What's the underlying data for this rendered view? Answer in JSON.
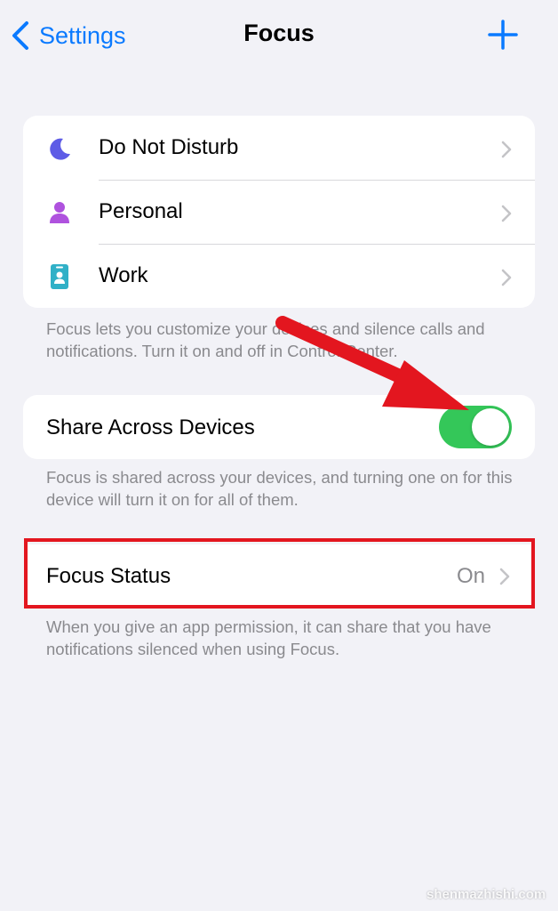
{
  "nav": {
    "back_label": "Settings",
    "title": "Focus"
  },
  "focus_modes": [
    {
      "label": "Do Not Disturb",
      "icon": "moon-icon",
      "color": "#5e5ce6"
    },
    {
      "label": "Personal",
      "icon": "person-icon",
      "color": "#af52de"
    },
    {
      "label": "Work",
      "icon": "id-badge-icon",
      "color": "#30b0c7"
    }
  ],
  "focus_modes_footer": "Focus lets you customize your devices and silence calls and notifications. Turn it on and off in Control Center.",
  "share": {
    "label": "Share Across Devices",
    "enabled": true,
    "footer": "Focus is shared across your devices, and turning one on for this device will turn it on for all of them."
  },
  "focus_status": {
    "label": "Focus Status",
    "value": "On",
    "footer": "When you give an app permission, it can share that you have notifications silenced when using Focus."
  },
  "watermark": "shenmazhishi.com",
  "colors": {
    "accent": "#0a7aff",
    "toggle_on": "#34c759",
    "annotation_red": "#e3161f"
  }
}
